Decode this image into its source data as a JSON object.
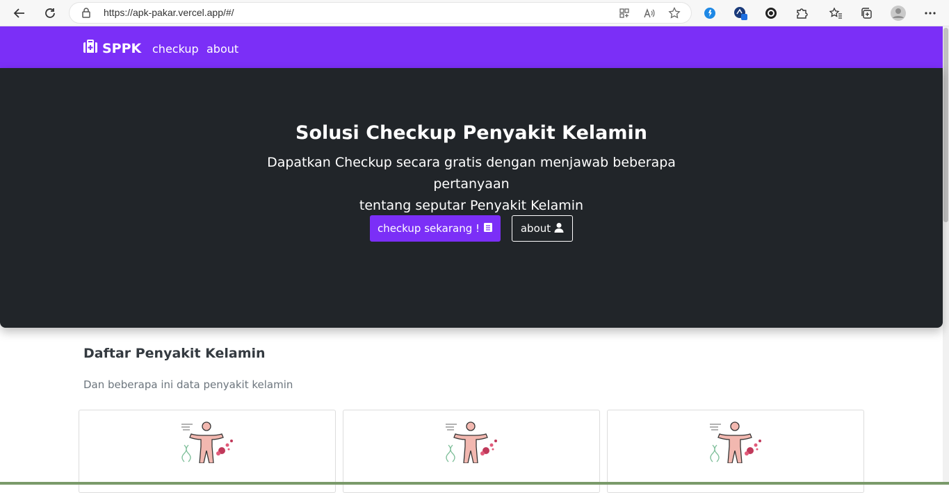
{
  "browser": {
    "url": "https://apk-pakar.vercel.app/#/"
  },
  "navbar": {
    "brand": "SPPK",
    "links": [
      "checkup",
      "about"
    ]
  },
  "hero": {
    "title": "Solusi Checkup Penyakit Kelamin",
    "lead_line1": "Dapatkan Checkup secara gratis dengan menjawab beberapa pertanyaan",
    "lead_line2": "tentang seputar Penyakit Kelamin",
    "primary_button": "checkup sekarang !",
    "secondary_button": "about"
  },
  "section": {
    "title": "Daftar Penyakit Kelamin",
    "subtitle": "Dan beberapa ini data penyakit kelamin"
  },
  "colors": {
    "brand": "#7b2ff7",
    "hero_bg": "#212529"
  },
  "icons": {
    "brand": "medkit-icon",
    "primary_button": "book-icon",
    "secondary_button": "user-icon",
    "card_image": "body-illustration"
  }
}
